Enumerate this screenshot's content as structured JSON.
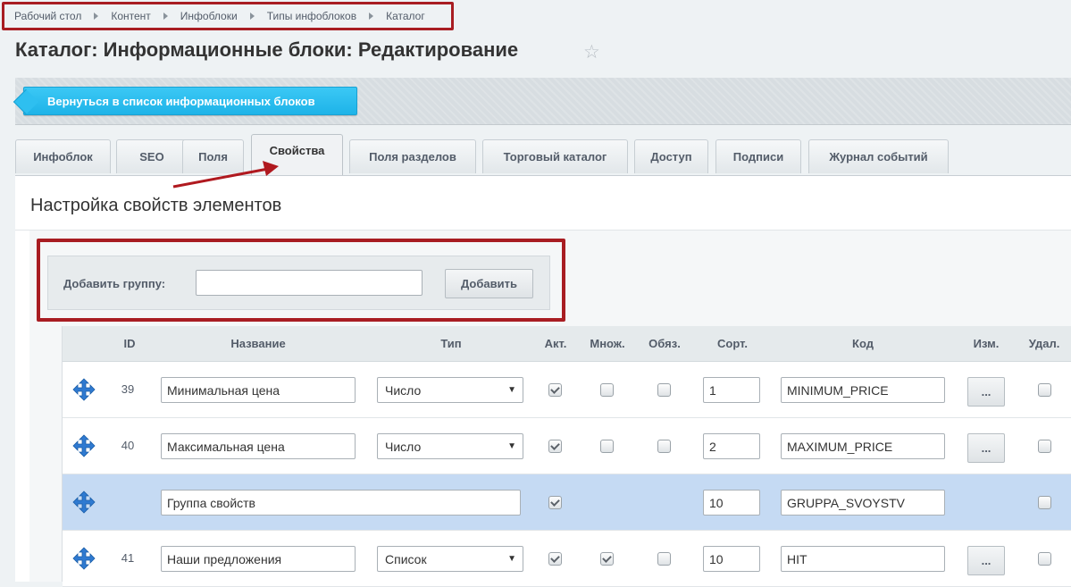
{
  "breadcrumb": [
    "Рабочий стол",
    "Контент",
    "Инфоблоки",
    "Типы инфоблоков",
    "Каталог"
  ],
  "page_title": "Каталог: Информационные блоки: Редактирование",
  "toolbar": {
    "back_label": "Вернуться в список информационных блоков"
  },
  "tabs": [
    {
      "label": "Инфоблок"
    },
    {
      "label": "SEO"
    },
    {
      "label": "Поля"
    },
    {
      "label": "Свойства",
      "active": true
    },
    {
      "label": "Поля разделов"
    },
    {
      "label": "Торговый каталог"
    },
    {
      "label": "Доступ"
    },
    {
      "label": "Подписи"
    },
    {
      "label": "Журнал событий"
    }
  ],
  "section_title": "Настройка свойств элементов",
  "add_group": {
    "label": "Добавить группу:",
    "value": "",
    "button_label": "Добавить"
  },
  "table": {
    "headers": [
      "ID",
      "Название",
      "Тип",
      "Акт.",
      "Множ.",
      "Обяз.",
      "Сорт.",
      "Код",
      "Изм.",
      "Удал."
    ],
    "rows": [
      {
        "id": "39",
        "name": "Минимальная цена",
        "type": "Число",
        "active": true,
        "multiple": false,
        "required": false,
        "sort": "1",
        "code": "MINIMUM_PRICE",
        "edit_label": "...",
        "delete": false
      },
      {
        "id": "40",
        "name": "Максимальная цена",
        "type": "Число",
        "active": true,
        "multiple": false,
        "required": false,
        "sort": "2",
        "code": "MAXIMUM_PRICE",
        "edit_label": "...",
        "delete": false
      },
      {
        "id": "",
        "name": "Группа свойств",
        "group": true,
        "active": true,
        "sort": "10",
        "code": "GRUPPA_SVOYSTV",
        "delete": false
      },
      {
        "id": "41",
        "name": "Наши предложения",
        "type": "Список",
        "active": true,
        "multiple": true,
        "required": false,
        "sort": "10",
        "code": "HIT",
        "edit_label": "...",
        "delete": false
      }
    ]
  },
  "colors": {
    "accent": "#3bc8f5",
    "highlight_frame": "#a81d22",
    "group_row": "#c5daf3"
  }
}
